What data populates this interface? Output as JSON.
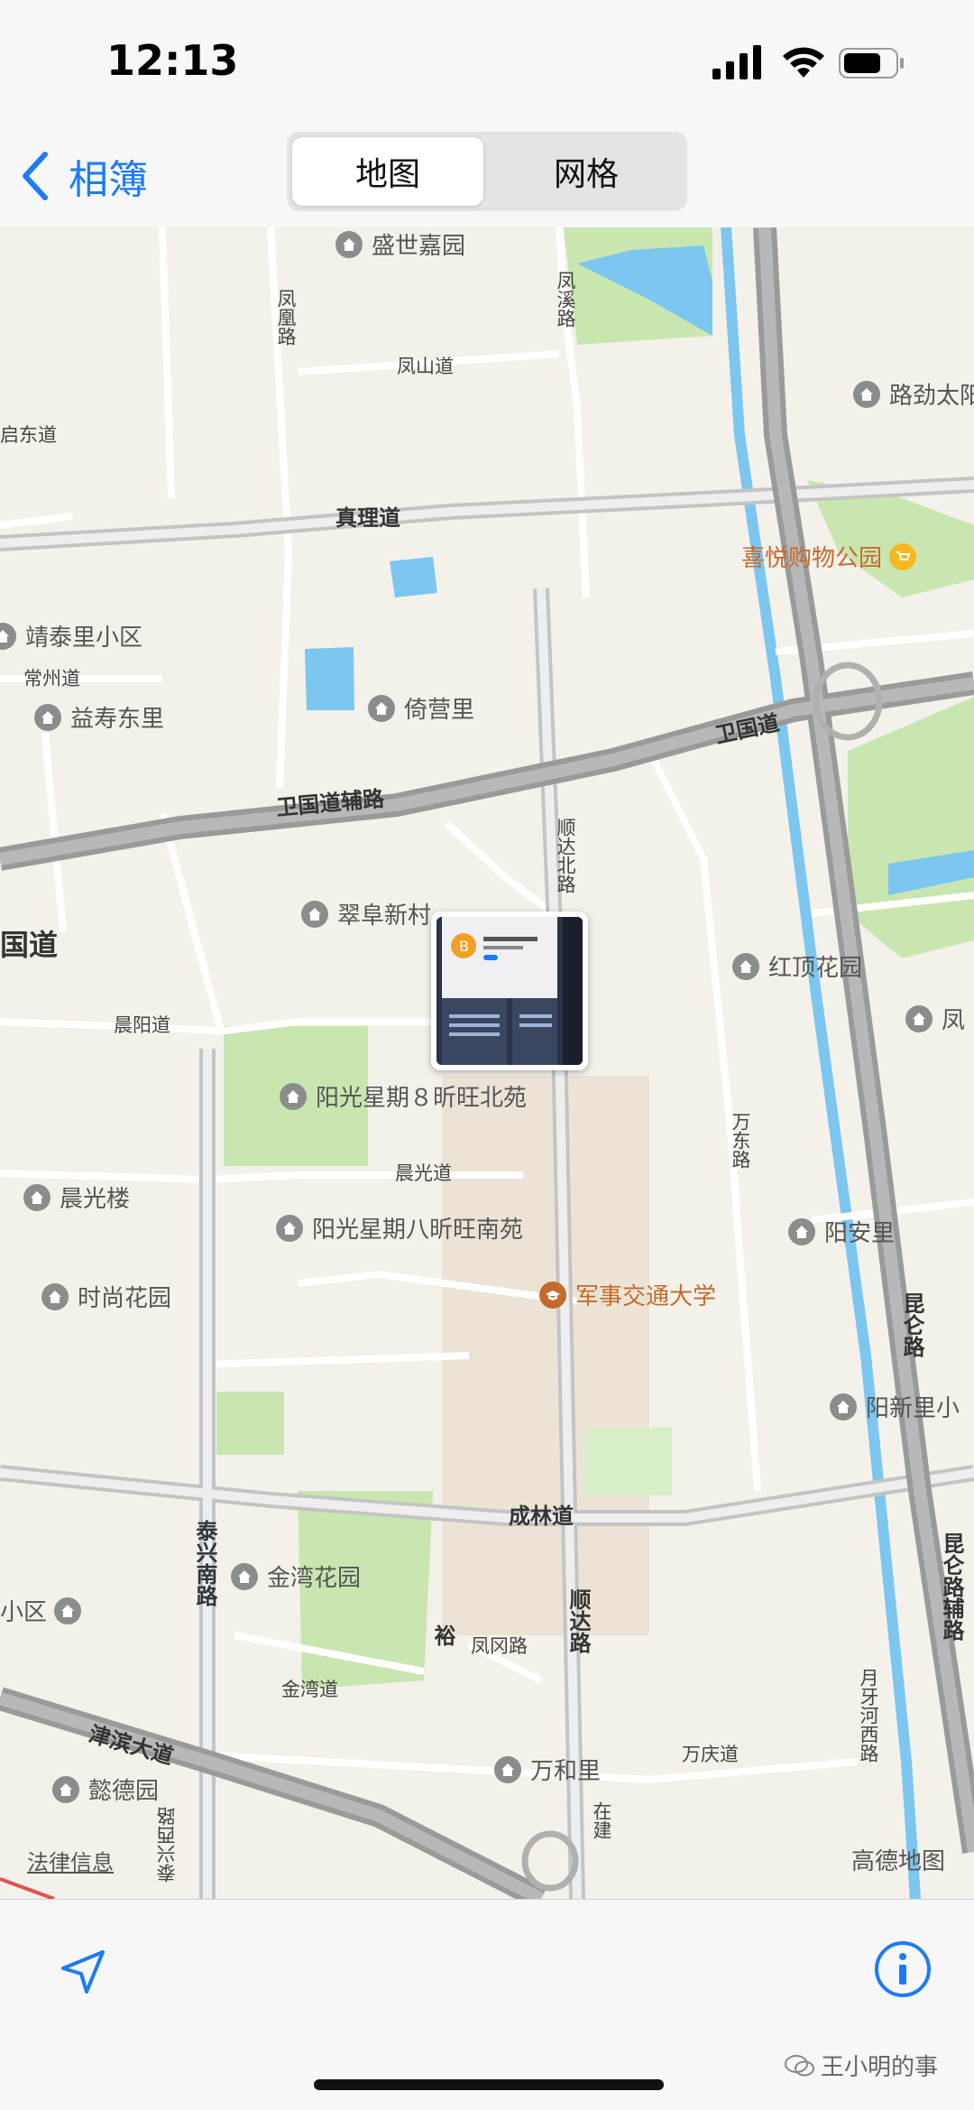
{
  "status_bar": {
    "time": "12:13"
  },
  "nav": {
    "back_label": "相簿",
    "segments": [
      {
        "label": "地图",
        "active": true
      },
      {
        "label": "网格",
        "active": false
      }
    ]
  },
  "map": {
    "pois": [
      {
        "name": "盛世嘉园"
      },
      {
        "name": "路劲太阳"
      },
      {
        "name": "喜悦购物公园"
      },
      {
        "name": "靖泰里小区"
      },
      {
        "name": "益寿东里"
      },
      {
        "name": "倚营里"
      },
      {
        "name": "翠阜新村"
      },
      {
        "name": "红顶花园"
      },
      {
        "name": "凤"
      },
      {
        "name": "阳光星期８昕旺北苑"
      },
      {
        "name": "晨光楼"
      },
      {
        "name": "阳光星期八昕旺南苑"
      },
      {
        "name": "阳安里"
      },
      {
        "name": "时尚花园"
      },
      {
        "name": "军事交通大学"
      },
      {
        "name": "阳新里小"
      },
      {
        "name": "金湾花园"
      },
      {
        "name": "小区"
      },
      {
        "name": "万和里"
      },
      {
        "name": "懿德园"
      }
    ],
    "roads": {
      "fenghuang": "凤凰路",
      "fengxi": "凤溪路",
      "fengshan": "凤山道",
      "qidong": "启东道",
      "zhenli": "真理道",
      "changzhou": "常州道",
      "weiguo": "卫国道",
      "weiguo_fulu": "卫国道辅路",
      "shunda_bei": "顺达北路",
      "guodao": "国道",
      "chenyang": "晨阳道",
      "chenguang": "晨光道",
      "wandong": "万东路",
      "kunlun": "昆仑路",
      "chenglin": "成林道",
      "taixing_nan": "泰兴南路",
      "shunda": "顺达路",
      "fengfeng": "凤冈路",
      "jinwan": "金湾道",
      "jinbin": "津滨大道",
      "taixing_xi": "泰兴西路",
      "wanqing": "万庆道",
      "kunlun_fulu": "昆仑路辅路",
      "yueya": "月牙河西路",
      "zaijian": "在建",
      "yuxin": "裕"
    },
    "legal": "法律信息",
    "provider": "高德地图"
  },
  "watermark": "王小明的事",
  "colors": {
    "accent": "#1d7bf5",
    "water": "#7cc6f0",
    "park": "#c9e6b0",
    "highway": "#9a9a9a"
  }
}
